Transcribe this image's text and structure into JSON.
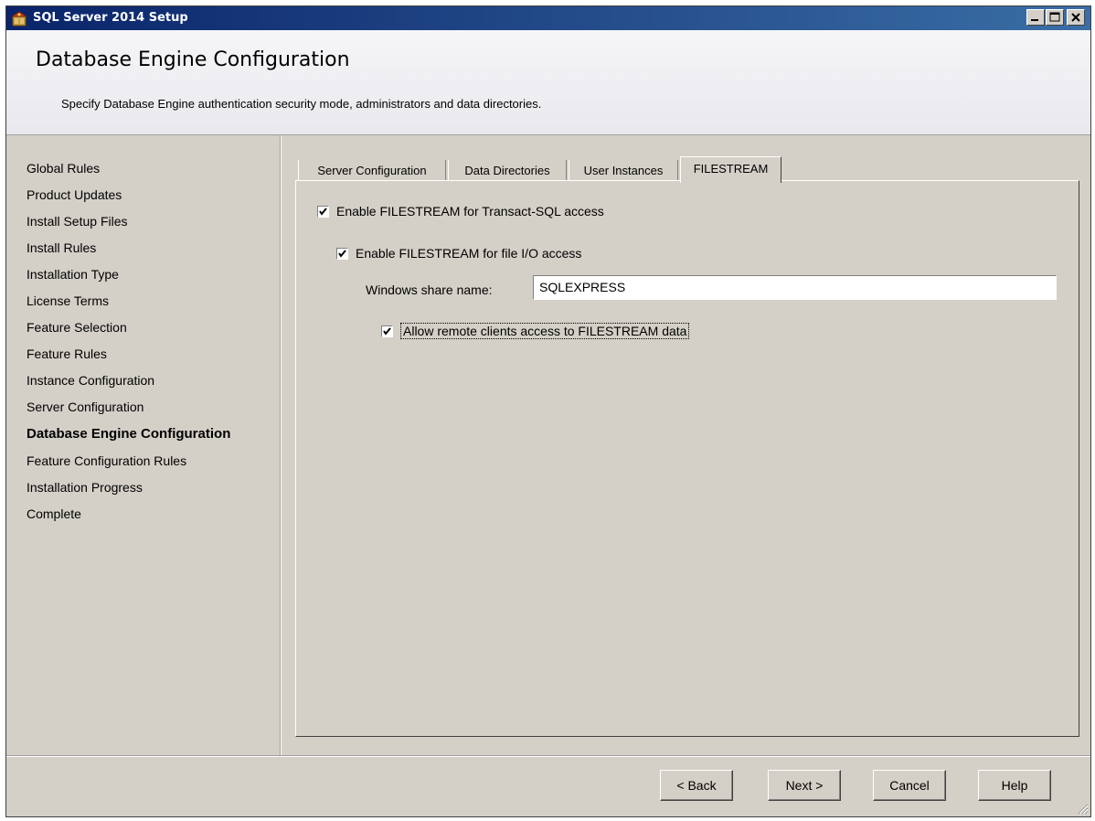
{
  "window": {
    "title": "SQL Server 2014 Setup"
  },
  "header": {
    "title": "Database Engine Configuration",
    "description": "Specify Database Engine authentication security mode, administrators and data directories."
  },
  "sidebar": {
    "items": [
      {
        "label": "Global Rules",
        "active": false
      },
      {
        "label": "Product Updates",
        "active": false
      },
      {
        "label": "Install Setup Files",
        "active": false
      },
      {
        "label": "Install Rules",
        "active": false
      },
      {
        "label": "Installation Type",
        "active": false
      },
      {
        "label": "License Terms",
        "active": false
      },
      {
        "label": "Feature Selection",
        "active": false
      },
      {
        "label": "Feature Rules",
        "active": false
      },
      {
        "label": "Instance Configuration",
        "active": false
      },
      {
        "label": "Server Configuration",
        "active": false
      },
      {
        "label": "Database Engine Configuration",
        "active": true
      },
      {
        "label": "Feature Configuration Rules",
        "active": false
      },
      {
        "label": "Installation Progress",
        "active": false
      },
      {
        "label": "Complete",
        "active": false
      }
    ]
  },
  "tabs": [
    {
      "label": "Server Configuration",
      "selected": false
    },
    {
      "label": "Data Directories",
      "selected": false
    },
    {
      "label": "User Instances",
      "selected": false
    },
    {
      "label": "FILESTREAM",
      "selected": true
    }
  ],
  "filestream": {
    "enable_tsql": {
      "label": "Enable FILESTREAM for Transact-SQL access",
      "checked": true
    },
    "enable_fileio": {
      "label": "Enable FILESTREAM for file I/O access",
      "checked": true
    },
    "share_name_label": "Windows share name:",
    "share_name_value": "SQLEXPRESS",
    "allow_remote": {
      "label": "Allow remote clients access to FILESTREAM data",
      "checked": true
    }
  },
  "footer": {
    "back": "< Back",
    "next": "Next >",
    "cancel": "Cancel",
    "help": "Help"
  },
  "colors": {
    "titlebar_start": "#0a246a",
    "titlebar_end": "#3a6ea5",
    "window_face": "#d4d0c8"
  }
}
